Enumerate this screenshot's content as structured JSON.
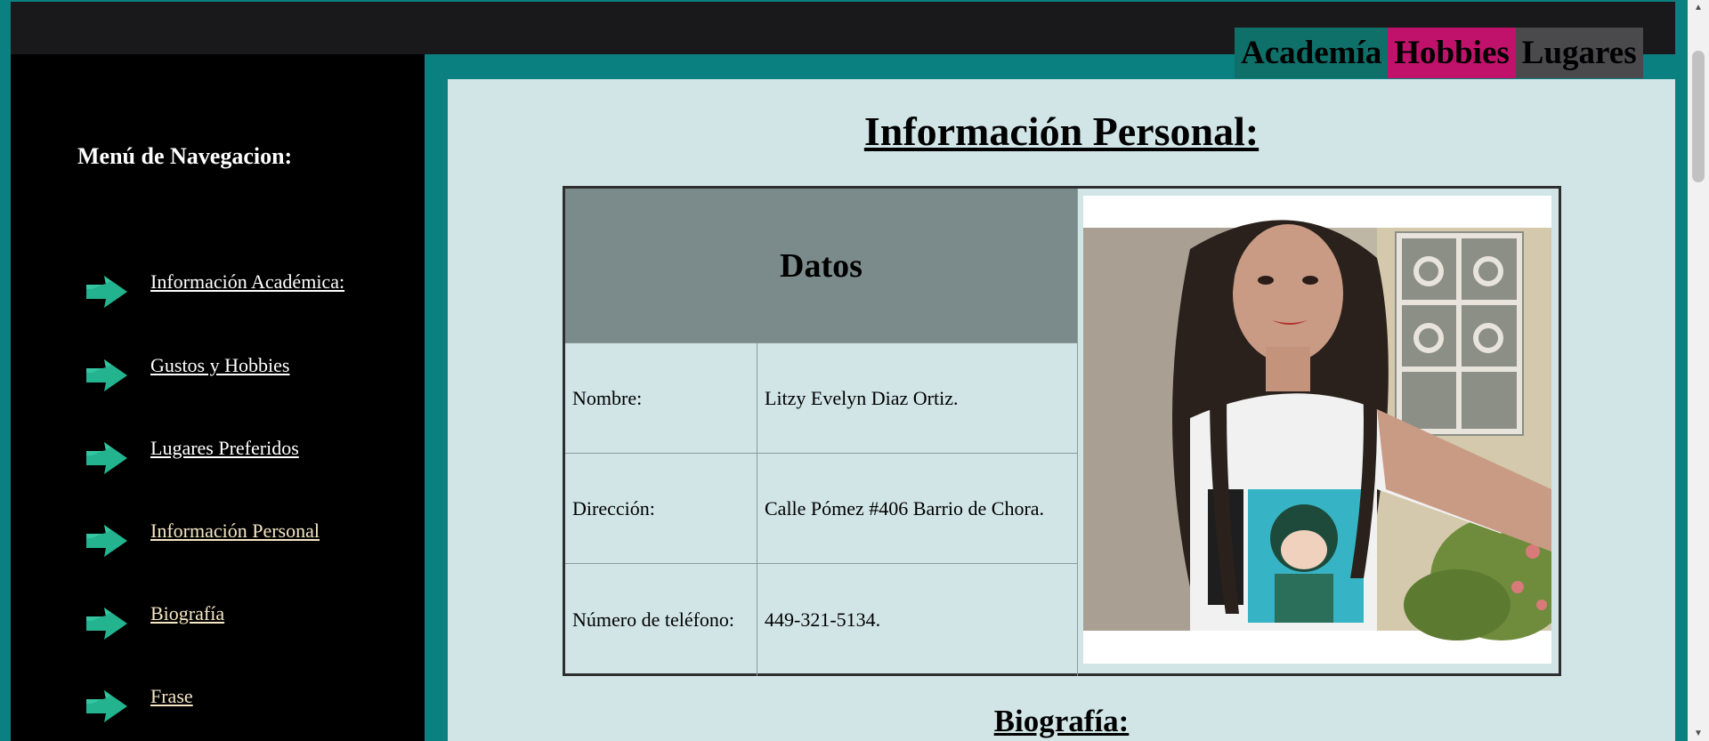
{
  "top_tabs": [
    {
      "label": "Academía",
      "color": "#0f6f69"
    },
    {
      "label": "Hobbies",
      "color": "#c1126b"
    },
    {
      "label": "Lugares",
      "color": "#4a4a4d"
    }
  ],
  "sidebar": {
    "title": "Menú de Navegacion:",
    "items": [
      {
        "label": "Información Académica:",
        "icon": "arrow-right-icon"
      },
      {
        "label": "Gustos y Hobbies",
        "icon": "arrow-right-icon"
      },
      {
        "label": "Lugares Preferidos",
        "icon": "arrow-right-icon"
      },
      {
        "label": "Información Personal",
        "icon": "arrow-right-icon"
      },
      {
        "label": "Biografía",
        "icon": "arrow-right-icon"
      },
      {
        "label": "Frase",
        "icon": "arrow-right-icon"
      }
    ]
  },
  "main": {
    "title": "Información Personal:",
    "table": {
      "header": "Datos",
      "rows": [
        {
          "label": "Nombre:",
          "value": "Litzy Evelyn Diaz Ortiz."
        },
        {
          "label": "Dirección:",
          "value": "Calle Pómez #406 Barrio de Chora."
        },
        {
          "label": "Número de teléfono:",
          "value": "449-321-5134."
        }
      ]
    },
    "photo": "profile-photo",
    "section_title": "Biografía:"
  },
  "colors": {
    "teal_bg": "#0b8080",
    "main_bg": "#d1e5e7",
    "header_cell": "#7b8b8b",
    "arrow": "#23b48f",
    "link_white": "#ffffff",
    "link_visited": "#f5e6c4"
  }
}
